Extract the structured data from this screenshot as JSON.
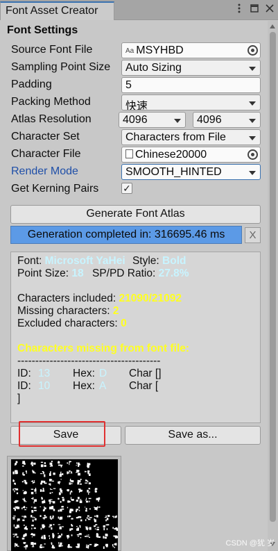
{
  "window": {
    "tab_title": "Font Asset Creator",
    "icons": [
      "more-vertical-icon",
      "maximize-icon",
      "close-icon"
    ]
  },
  "section_title": "Font Settings",
  "settings": {
    "source_font_file": {
      "label": "Source Font File",
      "value": "MSYHBD",
      "icon_text": "Aa"
    },
    "sampling_point_size": {
      "label": "Sampling Point Size",
      "value": "Auto Sizing"
    },
    "padding": {
      "label": "Padding",
      "value": "5"
    },
    "packing_method": {
      "label": "Packing Method",
      "value": "快速"
    },
    "atlas_resolution": {
      "label": "Atlas Resolution",
      "width": "4096",
      "height": "4096"
    },
    "character_set": {
      "label": "Character Set",
      "value": "Characters from File"
    },
    "character_file": {
      "label": "Character File",
      "value": "Chinese20000"
    },
    "render_mode": {
      "label": "Render Mode",
      "value": "SMOOTH_HINTED"
    },
    "get_kerning_pairs": {
      "label": "Get Kerning Pairs",
      "checked": true,
      "mark": "✓"
    }
  },
  "generate_button": "Generate Font Atlas",
  "progress": {
    "text": "Generation completed in: 316695.46 ms",
    "value": 1.0,
    "close_label": "X"
  },
  "info": {
    "font_label": "Font:",
    "font_value": "Microsoft YaHei",
    "style_label": "Style:",
    "style_value": "Bold",
    "point_size_label": "Point Size:",
    "point_size_value": "18",
    "ratio_label": "SP/PD Ratio:",
    "ratio_value": "27.8%",
    "included_label": "Characters included:",
    "included_value": "21090/21092",
    "missing_label": "Missing characters:",
    "missing_value": "2",
    "excluded_label": "Excluded characters:",
    "excluded_value": "0",
    "missing_title": "Characters missing from font file:",
    "separator": "----------------------------------------",
    "rows": [
      {
        "id_label": "ID:",
        "id": "13",
        "hex_label": "Hex:",
        "hex": "D",
        "char_label": "Char []"
      },
      {
        "id_label": "ID:",
        "id": "10",
        "hex_label": "Hex:",
        "hex": "A",
        "char_label": "Char ["
      }
    ],
    "closing": "]"
  },
  "save_button": "Save",
  "save_as_button": "Save as...",
  "watermark": "CSDN @犹 岁",
  "colors": {
    "accent": "#3a72b0",
    "progress": "#5c9ae6",
    "highlight": "#e03030",
    "cyan_text": "#c8f4ff",
    "yellow_text": "#ffff22"
  }
}
